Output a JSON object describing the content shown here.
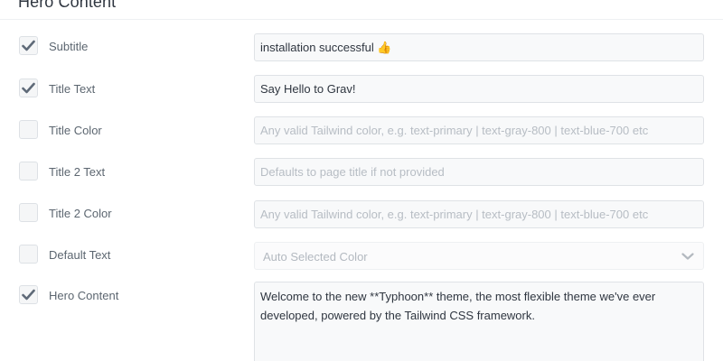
{
  "section": {
    "title": "Hero Content"
  },
  "rows": [
    {
      "label": "Subtitle",
      "checked": true,
      "type": "input",
      "value": "installation successful 👍",
      "placeholder": ""
    },
    {
      "label": "Title Text",
      "checked": true,
      "type": "input",
      "value": "Say Hello to Grav!",
      "placeholder": ""
    },
    {
      "label": "Title Color",
      "checked": false,
      "type": "input",
      "value": "",
      "placeholder": "Any valid Tailwind color, e.g. text-primary | text-gray-800 | text-blue-700 etc"
    },
    {
      "label": "Title 2 Text",
      "checked": false,
      "type": "input",
      "value": "",
      "placeholder": "Defaults to page title if not provided"
    },
    {
      "label": "Title 2 Color",
      "checked": false,
      "type": "input",
      "value": "",
      "placeholder": "Any valid Tailwind color, e.g. text-primary | text-gray-800 | text-blue-700 etc"
    },
    {
      "label": "Default Text",
      "checked": false,
      "type": "select",
      "value": "Auto Selected Color",
      "placeholder": ""
    },
    {
      "label": "Hero Content",
      "checked": true,
      "type": "textarea",
      "value": "Welcome to the new **Typhoon** theme, the most flexible theme we've ever developed, powered by the Tailwind CSS framework.",
      "placeholder": ""
    }
  ],
  "colors": {
    "check_mark": "#5f6a78",
    "field_bg": "#f8f9fa",
    "field_border": "#dfe2e6",
    "placeholder": "#b7bdc4"
  },
  "icons": {
    "checkbox": "check-icon",
    "select": "chevron-down-icon"
  }
}
